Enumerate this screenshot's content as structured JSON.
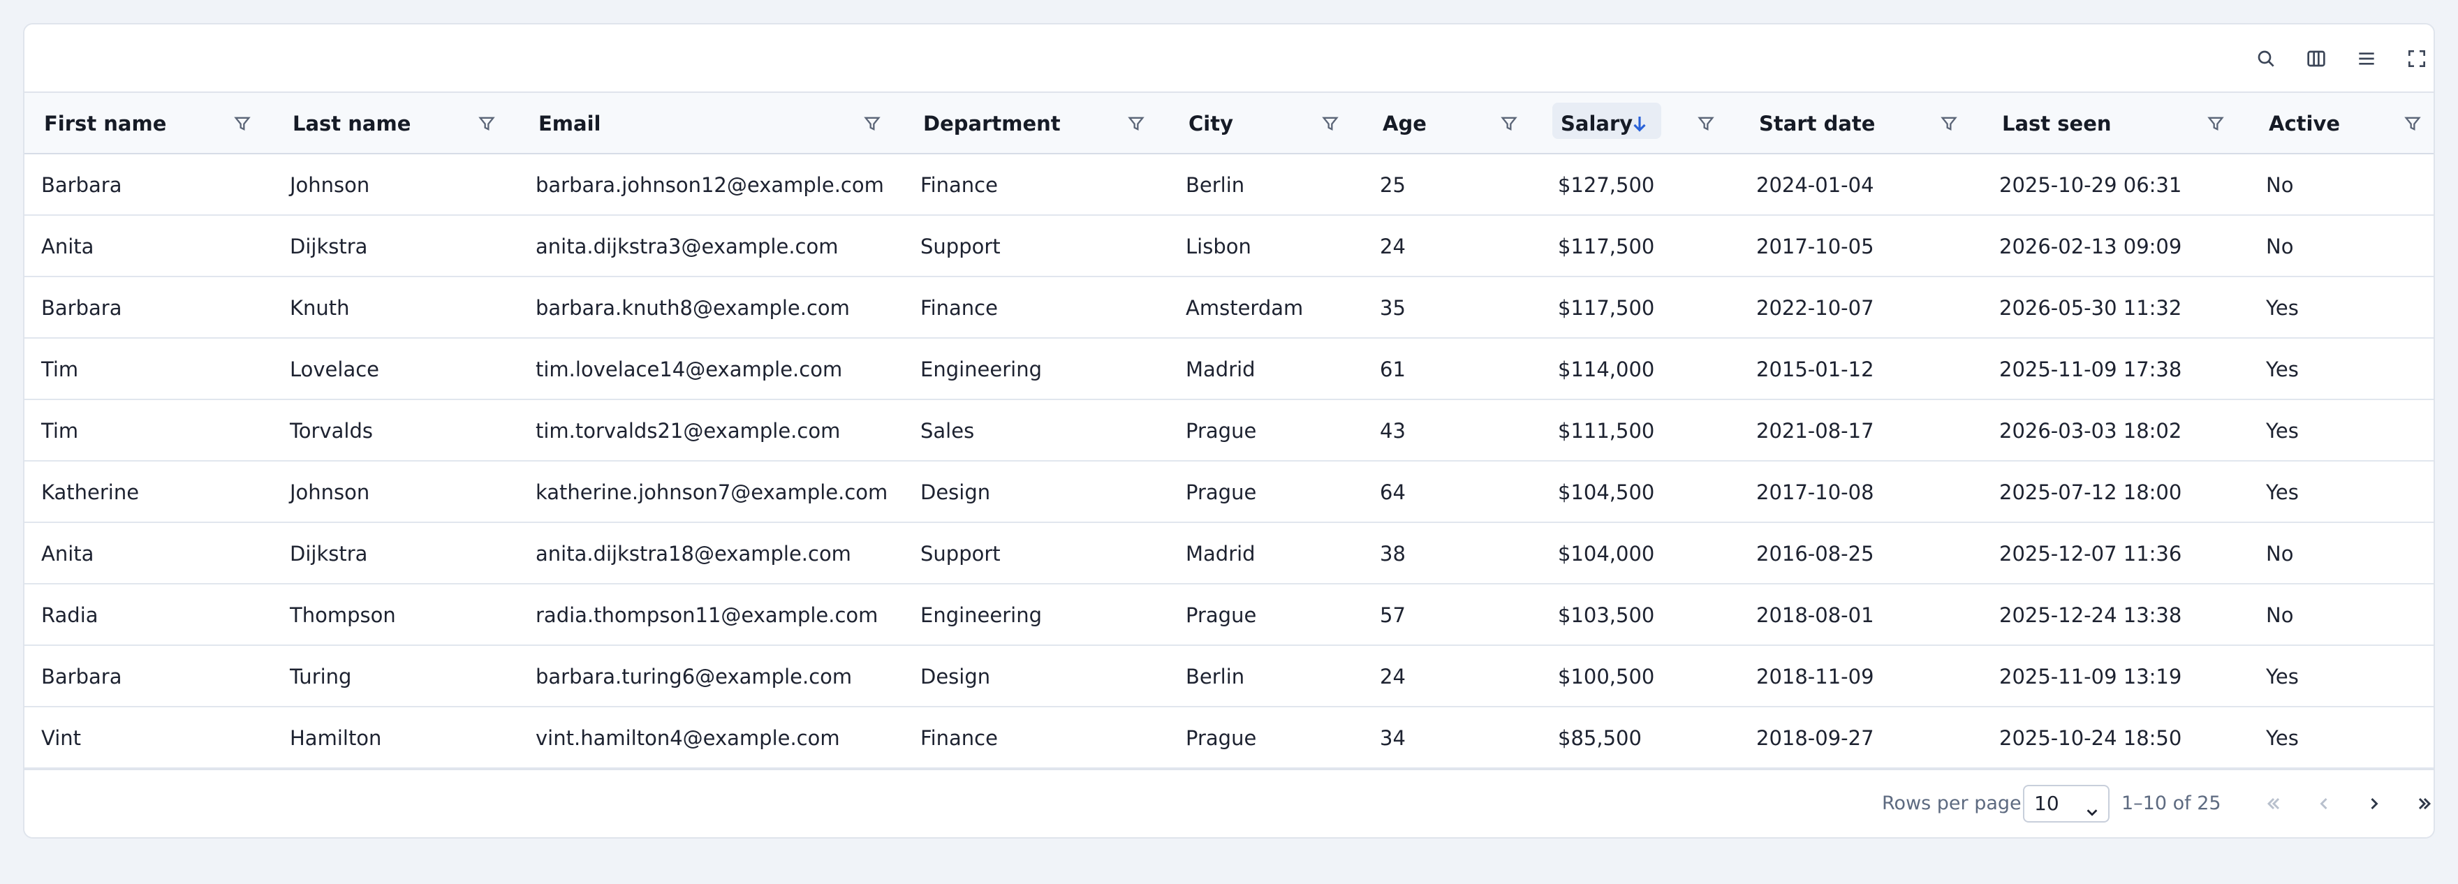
{
  "toolbar": {
    "actions": [
      {
        "name": "search-button",
        "icon": "search-icon"
      },
      {
        "name": "columns-button",
        "icon": "columns-icon"
      },
      {
        "name": "density-button",
        "icon": "menu-lines-icon"
      },
      {
        "name": "fullscreen-button",
        "icon": "fullscreen-icon"
      }
    ]
  },
  "table": {
    "columns": [
      {
        "key": "first",
        "label": "First name"
      },
      {
        "key": "last",
        "label": "Last name"
      },
      {
        "key": "email",
        "label": "Email"
      },
      {
        "key": "dept",
        "label": "Department"
      },
      {
        "key": "city",
        "label": "City"
      },
      {
        "key": "age",
        "label": "Age"
      },
      {
        "key": "salary",
        "label": "Salary",
        "sorted": "desc"
      },
      {
        "key": "start",
        "label": "Start date"
      },
      {
        "key": "seen",
        "label": "Last seen"
      },
      {
        "key": "active",
        "label": "Active"
      }
    ],
    "rows": [
      [
        "Barbara",
        "Johnson",
        "barbara.johnson12@example.com",
        "Finance",
        "Berlin",
        "25",
        "$127,500",
        "2024-01-04",
        "2025-10-29 06:31",
        "No"
      ],
      [
        "Anita",
        "Dijkstra",
        "anita.dijkstra3@example.com",
        "Support",
        "Lisbon",
        "24",
        "$117,500",
        "2017-10-05",
        "2026-02-13 09:09",
        "No"
      ],
      [
        "Barbara",
        "Knuth",
        "barbara.knuth8@example.com",
        "Finance",
        "Amsterdam",
        "35",
        "$117,500",
        "2022-10-07",
        "2026-05-30 11:32",
        "Yes"
      ],
      [
        "Tim",
        "Lovelace",
        "tim.lovelace14@example.com",
        "Engineering",
        "Madrid",
        "61",
        "$114,000",
        "2015-01-12",
        "2025-11-09 17:38",
        "Yes"
      ],
      [
        "Tim",
        "Torvalds",
        "tim.torvalds21@example.com",
        "Sales",
        "Prague",
        "43",
        "$111,500",
        "2021-08-17",
        "2026-03-03 18:02",
        "Yes"
      ],
      [
        "Katherine",
        "Johnson",
        "katherine.johnson7@example.com",
        "Design",
        "Prague",
        "64",
        "$104,500",
        "2017-10-08",
        "2025-07-12 18:00",
        "Yes"
      ],
      [
        "Anita",
        "Dijkstra",
        "anita.dijkstra18@example.com",
        "Support",
        "Madrid",
        "38",
        "$104,000",
        "2016-08-25",
        "2025-12-07 11:36",
        "No"
      ],
      [
        "Radia",
        "Thompson",
        "radia.thompson11@example.com",
        "Engineering",
        "Prague",
        "57",
        "$103,500",
        "2018-08-01",
        "2025-12-24 13:38",
        "No"
      ],
      [
        "Barbara",
        "Turing",
        "barbara.turing6@example.com",
        "Design",
        "Berlin",
        "24",
        "$100,500",
        "2018-11-09",
        "2025-11-09 13:19",
        "Yes"
      ],
      [
        "Vint",
        "Hamilton",
        "vint.hamilton4@example.com",
        "Finance",
        "Prague",
        "34",
        "$85,500",
        "2018-09-27",
        "2025-10-24 18:50",
        "Yes"
      ]
    ]
  },
  "footer": {
    "rows_per_page_label": "Rows per page",
    "rows_per_page_value": "10",
    "range_text": "1–10 of 25",
    "pagination": [
      {
        "name": "first-page-button",
        "icon": "double-chevron-left-icon",
        "enabled": false
      },
      {
        "name": "prev-page-button",
        "icon": "chevron-left-icon",
        "enabled": false
      },
      {
        "name": "next-page-button",
        "icon": "chevron-right-icon",
        "enabled": true
      },
      {
        "name": "last-page-button",
        "icon": "double-chevron-right-icon",
        "enabled": true
      }
    ]
  },
  "colors": {
    "page_bg": "#f0f3f8",
    "header_bg": "#f7f9fc",
    "sort_accent": "#2a62d8",
    "muted_text": "#5d6a80"
  }
}
